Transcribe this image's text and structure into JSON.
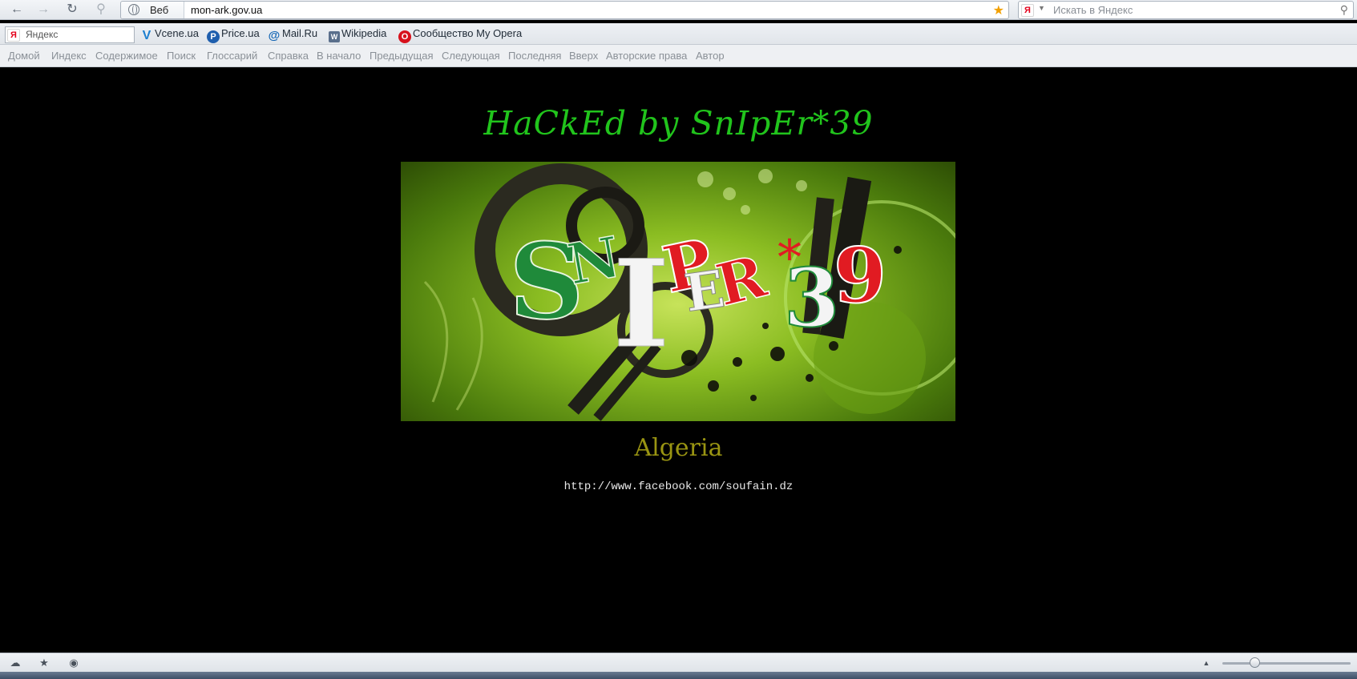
{
  "browser": {
    "address_zone_label": "Веб",
    "url": "mon-ark.gov.ua",
    "search_placeholder": "Искать в Яндекс",
    "yandex_box_text": "Яндекс",
    "yandex_logo": "Я"
  },
  "bookmarks": [
    {
      "label": "Vcene.ua",
      "icon": "V"
    },
    {
      "label": "Price.ua",
      "icon": "P"
    },
    {
      "label": "Mail.Ru",
      "icon": "@"
    },
    {
      "label": "Wikipedia",
      "icon": "W"
    },
    {
      "label": "Сообщество My Opera",
      "icon": "O"
    }
  ],
  "nav_links": [
    "Домой",
    "Индекс",
    "Содержимое",
    "Поиск",
    "Глоссарий",
    "Справка",
    "В начало",
    "Предыдущая",
    "Следующая",
    "Последняя",
    "Вверх",
    "Авторские права",
    "Автор"
  ],
  "page": {
    "title": "HaCkEd by SnIpEr*39",
    "banner_text": "SNIPER*39",
    "subtitle": "Algeria",
    "link": "http://www.facebook.com/soufain.dz"
  },
  "zoom_fraction": 0.25,
  "colors": {
    "title": "#21c41c",
    "subtitle": "#999412",
    "background": "#000000"
  }
}
